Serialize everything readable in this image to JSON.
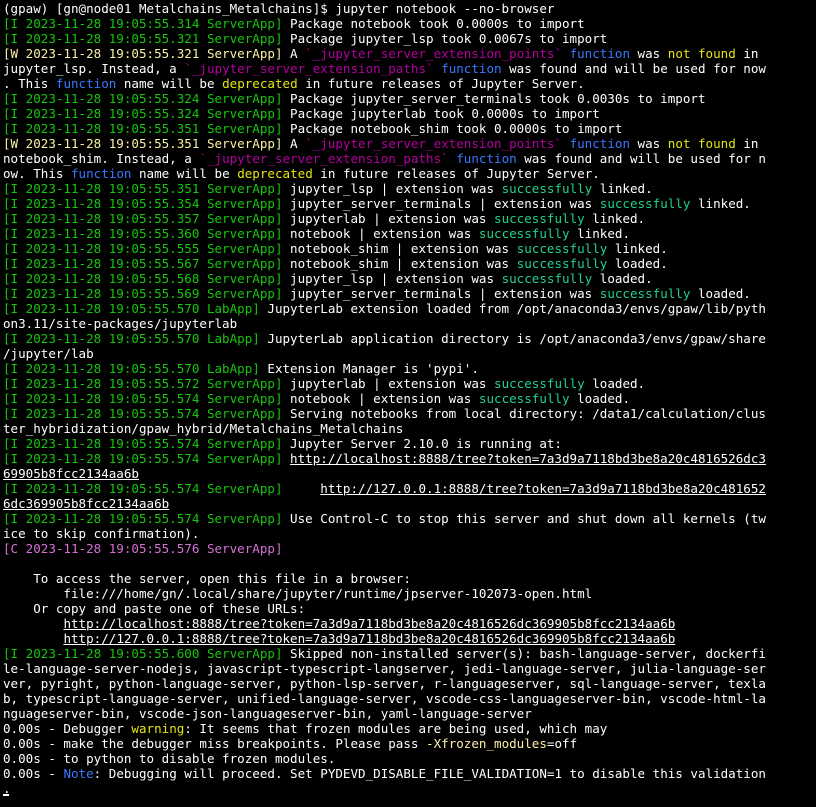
{
  "terminal": {
    "colors": {
      "background": "#000000",
      "default": "#ffffff",
      "info_tag": "#16c60c",
      "warn_tag": "#f9f1a5",
      "crit_tag": "#d670d6",
      "keyword": "#3b78ff",
      "highlight_yellow": "#e5e510",
      "quoted": "#b4009e",
      "success": "#23d18b"
    },
    "lines": [
      [
        {
          "t": "(gpaw) [gn@node01 Metalchains_Metalchains]$ jupyter notebook --no-browser",
          "c": "w"
        }
      ],
      [
        {
          "t": "[I 2023-11-28 19:05:55.314 ServerApp] ",
          "c": "g"
        },
        {
          "t": "Package notebook took 0.0000s to import",
          "c": "w"
        }
      ],
      [
        {
          "t": "[I 2023-11-28 19:05:55.321 ServerApp] ",
          "c": "g"
        },
        {
          "t": "Package jupyter_lsp took 0.0067s to import",
          "c": "w"
        }
      ],
      [
        {
          "t": "[W 2023-11-28 19:05:55.321 ServerApp] ",
          "c": "y"
        },
        {
          "t": "A ",
          "c": "w"
        },
        {
          "t": "`_jupyter_server_extension_points`",
          "c": "m"
        },
        {
          "t": " ",
          "c": "w"
        },
        {
          "t": "function",
          "c": "b"
        },
        {
          "t": " was ",
          "c": "w"
        },
        {
          "t": "not found",
          "c": "yy"
        },
        {
          "t": " in",
          "c": "w"
        }
      ],
      [
        {
          "t": "jupyter_lsp. Instead, a ",
          "c": "w"
        },
        {
          "t": "`_jupyter_server_extension_paths`",
          "c": "m"
        },
        {
          "t": " ",
          "c": "w"
        },
        {
          "t": "function",
          "c": "b"
        },
        {
          "t": " was found and will be used for now",
          "c": "w"
        }
      ],
      [
        {
          "t": ". This ",
          "c": "w"
        },
        {
          "t": "function",
          "c": "b"
        },
        {
          "t": " name will be ",
          "c": "w"
        },
        {
          "t": "deprecated",
          "c": "yy"
        },
        {
          "t": " in future releases of Jupyter Server.",
          "c": "w"
        }
      ],
      [
        {
          "t": "[I 2023-11-28 19:05:55.324 ServerApp] ",
          "c": "g"
        },
        {
          "t": "Package jupyter_server_terminals took 0.0030s to import",
          "c": "w"
        }
      ],
      [
        {
          "t": "[I 2023-11-28 19:05:55.324 ServerApp] ",
          "c": "g"
        },
        {
          "t": "Package jupyterlab took 0.0000s to import",
          "c": "w"
        }
      ],
      [
        {
          "t": "[I 2023-11-28 19:05:55.351 ServerApp] ",
          "c": "g"
        },
        {
          "t": "Package notebook_shim took 0.0000s to import",
          "c": "w"
        }
      ],
      [
        {
          "t": "[W 2023-11-28 19:05:55.351 ServerApp] ",
          "c": "y"
        },
        {
          "t": "A ",
          "c": "w"
        },
        {
          "t": "`_jupyter_server_extension_points`",
          "c": "m"
        },
        {
          "t": " ",
          "c": "w"
        },
        {
          "t": "function",
          "c": "b"
        },
        {
          "t": " was ",
          "c": "w"
        },
        {
          "t": "not found",
          "c": "yy"
        },
        {
          "t": " in",
          "c": "w"
        }
      ],
      [
        {
          "t": "notebook_shim. Instead, a ",
          "c": "w"
        },
        {
          "t": "`_jupyter_server_extension_paths`",
          "c": "m"
        },
        {
          "t": " ",
          "c": "w"
        },
        {
          "t": "function",
          "c": "b"
        },
        {
          "t": " was found and will be used for n",
          "c": "w"
        }
      ],
      [
        {
          "t": "ow. This ",
          "c": "w"
        },
        {
          "t": "function",
          "c": "b"
        },
        {
          "t": " name will be ",
          "c": "w"
        },
        {
          "t": "deprecated",
          "c": "yy"
        },
        {
          "t": " in future releases of Jupyter Server.",
          "c": "w"
        }
      ],
      [
        {
          "t": "[I 2023-11-28 19:05:55.351 ServerApp] ",
          "c": "g"
        },
        {
          "t": "jupyter_lsp | extension was ",
          "c": "w"
        },
        {
          "t": "successfully",
          "c": "gg"
        },
        {
          "t": " linked.",
          "c": "w"
        }
      ],
      [
        {
          "t": "[I 2023-11-28 19:05:55.354 ServerApp] ",
          "c": "g"
        },
        {
          "t": "jupyter_server_terminals | extension was ",
          "c": "w"
        },
        {
          "t": "successfully",
          "c": "gg"
        },
        {
          "t": " linked.",
          "c": "w"
        }
      ],
      [
        {
          "t": "[I 2023-11-28 19:05:55.357 ServerApp] ",
          "c": "g"
        },
        {
          "t": "jupyterlab | extension was ",
          "c": "w"
        },
        {
          "t": "successfully",
          "c": "gg"
        },
        {
          "t": " linked.",
          "c": "w"
        }
      ],
      [
        {
          "t": "[I 2023-11-28 19:05:55.360 ServerApp] ",
          "c": "g"
        },
        {
          "t": "notebook | extension was ",
          "c": "w"
        },
        {
          "t": "successfully",
          "c": "gg"
        },
        {
          "t": " linked.",
          "c": "w"
        }
      ],
      [
        {
          "t": "[I 2023-11-28 19:05:55.555 ServerApp] ",
          "c": "g"
        },
        {
          "t": "notebook_shim | extension was ",
          "c": "w"
        },
        {
          "t": "successfully",
          "c": "gg"
        },
        {
          "t": " linked.",
          "c": "w"
        }
      ],
      [
        {
          "t": "[I 2023-11-28 19:05:55.567 ServerApp] ",
          "c": "g"
        },
        {
          "t": "notebook_shim | extension was ",
          "c": "w"
        },
        {
          "t": "successfully",
          "c": "gg"
        },
        {
          "t": " loaded.",
          "c": "w"
        }
      ],
      [
        {
          "t": "[I 2023-11-28 19:05:55.568 ServerApp] ",
          "c": "g"
        },
        {
          "t": "jupyter_lsp | extension was ",
          "c": "w"
        },
        {
          "t": "successfully",
          "c": "gg"
        },
        {
          "t": " loaded.",
          "c": "w"
        }
      ],
      [
        {
          "t": "[I 2023-11-28 19:05:55.569 ServerApp] ",
          "c": "g"
        },
        {
          "t": "jupyter_server_terminals | extension was ",
          "c": "w"
        },
        {
          "t": "successfully",
          "c": "gg"
        },
        {
          "t": " loaded.",
          "c": "w"
        }
      ],
      [
        {
          "t": "[I 2023-11-28 19:05:55.570 LabApp] ",
          "c": "g"
        },
        {
          "t": "JupyterLab extension loaded from /opt/anaconda3/envs/gpaw/lib/pyth",
          "c": "w"
        }
      ],
      [
        {
          "t": "on3.11/site-packages/jupyterlab",
          "c": "w"
        }
      ],
      [
        {
          "t": "[I 2023-11-28 19:05:55.570 LabApp] ",
          "c": "g"
        },
        {
          "t": "JupyterLab application directory is /opt/anaconda3/envs/gpaw/share",
          "c": "w"
        }
      ],
      [
        {
          "t": "/jupyter/lab",
          "c": "w"
        }
      ],
      [
        {
          "t": "[I 2023-11-28 19:05:55.570 LabApp] ",
          "c": "g"
        },
        {
          "t": "Extension Manager is 'pypi'.",
          "c": "w"
        }
      ],
      [
        {
          "t": "[I 2023-11-28 19:05:55.572 ServerApp] ",
          "c": "g"
        },
        {
          "t": "jupyterlab | extension was ",
          "c": "w"
        },
        {
          "t": "successfully",
          "c": "gg"
        },
        {
          "t": " loaded.",
          "c": "w"
        }
      ],
      [
        {
          "t": "[I 2023-11-28 19:05:55.574 ServerApp] ",
          "c": "g"
        },
        {
          "t": "notebook | extension was ",
          "c": "w"
        },
        {
          "t": "successfully",
          "c": "gg"
        },
        {
          "t": " loaded.",
          "c": "w"
        }
      ],
      [
        {
          "t": "[I 2023-11-28 19:05:55.574 ServerApp] ",
          "c": "g"
        },
        {
          "t": "Serving notebooks from local directory: /data1/calculation/clus",
          "c": "w"
        }
      ],
      [
        {
          "t": "ter_hybridization/gpaw_hybrid/Metalchains_Metalchains",
          "c": "w"
        }
      ],
      [
        {
          "t": "[I 2023-11-28 19:05:55.574 ServerApp] ",
          "c": "g"
        },
        {
          "t": "Jupyter Server 2.10.0 is running at:",
          "c": "w"
        }
      ],
      [
        {
          "t": "[I 2023-11-28 19:05:55.574 ServerApp] ",
          "c": "g"
        },
        {
          "t": "http://localhost:8888/tree?token=7a3d9a7118bd3be8a20c4816526dc3",
          "c": "w",
          "u": true,
          "link": true
        }
      ],
      [
        {
          "t": "69905b8fcc2134aa6b",
          "c": "w",
          "u": true,
          "link": true
        }
      ],
      [
        {
          "t": "[I 2023-11-28 19:05:55.574 ServerApp] ",
          "c": "g"
        },
        {
          "t": "    ",
          "c": "w"
        },
        {
          "t": "http://127.0.0.1:8888/tree?token=7a3d9a7118bd3be8a20c481652",
          "c": "w",
          "u": true,
          "link": true
        }
      ],
      [
        {
          "t": "6dc369905b8fcc2134aa6b",
          "c": "w",
          "u": true,
          "link": true
        }
      ],
      [
        {
          "t": "[I 2023-11-28 19:05:55.574 ServerApp] ",
          "c": "g"
        },
        {
          "t": "Use Control-C to stop this server and shut down all kernels (tw",
          "c": "w"
        }
      ],
      [
        {
          "t": "ice to skip confirmation).",
          "c": "w"
        }
      ],
      [
        {
          "t": "[C 2023-11-28 19:05:55.576 ServerApp]",
          "c": "mm"
        }
      ],
      [
        {
          "t": "",
          "c": "w"
        }
      ],
      [
        {
          "t": "    To access the server, open this file in a browser:",
          "c": "w"
        }
      ],
      [
        {
          "t": "        file:///home/gn/.local/share/jupyter/runtime/jpserver-102073-open.html",
          "c": "w"
        }
      ],
      [
        {
          "t": "    Or copy and paste one of these URLs:",
          "c": "w"
        }
      ],
      [
        {
          "t": "        ",
          "c": "w"
        },
        {
          "t": "http://localhost:8888/tree?token=7a3d9a7118bd3be8a20c4816526dc369905b8fcc2134aa6b",
          "c": "w",
          "u": true,
          "link": true
        }
      ],
      [
        {
          "t": "        ",
          "c": "w"
        },
        {
          "t": "http://127.0.0.1:8888/tree?token=7a3d9a7118bd3be8a20c4816526dc369905b8fcc2134aa6b",
          "c": "w",
          "u": true,
          "link": true
        }
      ],
      [
        {
          "t": "[I 2023-11-28 19:05:55.600 ServerApp] ",
          "c": "g"
        },
        {
          "t": "Skipped non-installed server(s): bash-language-server, dockerfi",
          "c": "w"
        }
      ],
      [
        {
          "t": "le-language-server-nodejs, javascript-typescript-langserver, jedi-language-server, julia-language-ser",
          "c": "w"
        }
      ],
      [
        {
          "t": "ver, pyright, python-language-server, python-lsp-server, r-languageserver, sql-language-server, texla",
          "c": "w"
        }
      ],
      [
        {
          "t": "b, typescript-language-server, unified-language-server, vscode-css-languageserver-bin, vscode-html-la",
          "c": "w"
        }
      ],
      [
        {
          "t": "nguageserver-bin, vscode-json-languageserver-bin, yaml-language-server",
          "c": "w"
        }
      ],
      [
        {
          "t": "0.00s - Debugger ",
          "c": "w"
        },
        {
          "t": "warning",
          "c": "yy"
        },
        {
          "t": ": It seems that frozen modules are being used, which may",
          "c": "w"
        }
      ],
      [
        {
          "t": "0.00s - make the debugger miss breakpoints. Please pass ",
          "c": "w"
        },
        {
          "t": "-Xfrozen_modules",
          "c": "y"
        },
        {
          "t": "=off",
          "c": "w"
        }
      ],
      [
        {
          "t": "0.00s - to python to disable frozen modules.",
          "c": "w"
        }
      ],
      [
        {
          "t": "0.00s - ",
          "c": "w"
        },
        {
          "t": "Note",
          "c": "b"
        },
        {
          "t": ": Debugging will proceed. Set PYDEVD_DISABLE_FILE_VALIDATION=1 to disable this validation",
          "c": "w"
        }
      ],
      [
        {
          "t": ".",
          "c": "w"
        }
      ]
    ]
  }
}
